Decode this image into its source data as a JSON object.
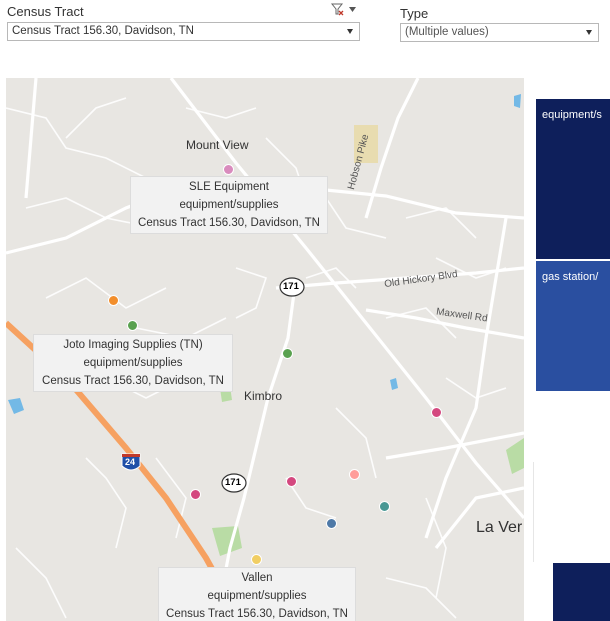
{
  "filters": {
    "census_tract": {
      "label": "Census Tract",
      "value": "Census Tract 156.30, Davidson, TN",
      "clear_icon": "clear-filter-icon"
    },
    "type": {
      "label": "Type",
      "value": "(Multiple values)"
    }
  },
  "map": {
    "places": [
      "Mount View",
      "Kimbro",
      "La Ver"
    ],
    "roads": [
      "Hobson Pike",
      "Old Hickory Blvd",
      "Maxwell Rd"
    ],
    "route_shields": [
      "171",
      "171"
    ],
    "interstate_shield": "24",
    "tooltips": [
      {
        "name": "SLE Equipment",
        "type": "equipment/supplies",
        "tract": "Census Tract 156.30, Davidson, TN"
      },
      {
        "name": "Joto Imaging Supplies (TN)",
        "type": "equipment/supplies",
        "tract": "Census Tract 156.30, Davidson, TN"
      },
      {
        "name": "Vallen",
        "type": "equipment/supplies",
        "tract": "Census Tract 156.30, Davidson, TN"
      }
    ],
    "markers": [
      {
        "color": "#d98bbd"
      },
      {
        "color": "#f28e2b"
      },
      {
        "color": "#59a14f"
      },
      {
        "color": "#59a14f"
      },
      {
        "color": "#d4487f"
      },
      {
        "color": "#ff9d9a"
      },
      {
        "color": "#d4487f"
      },
      {
        "color": "#d4487f"
      },
      {
        "color": "#4e79a7"
      },
      {
        "color": "#499894"
      },
      {
        "color": "#f1ce63"
      }
    ]
  },
  "type_blocks": [
    {
      "label": "equipment/s",
      "color": "#0e1f5b"
    },
    {
      "label": "gas station/",
      "color": "#2a4fa0"
    },
    {
      "label": "",
      "color": "#0e1f5b"
    }
  ]
}
